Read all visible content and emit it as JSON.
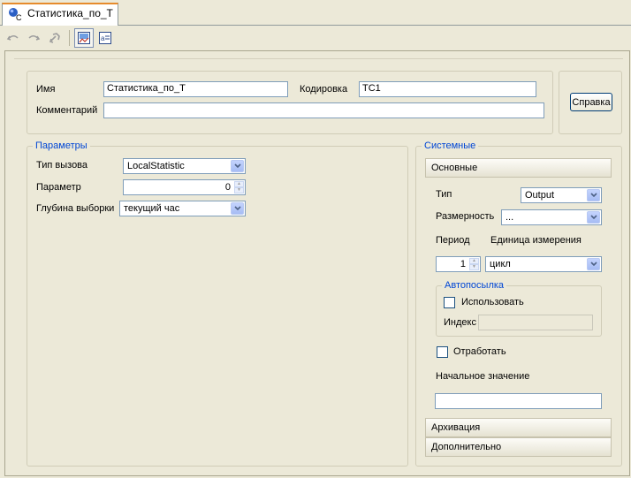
{
  "tab": {
    "label": "Статистика_по_Т",
    "icon": "function-block-icon"
  },
  "toolbar": {
    "undo_icon": "undo-icon",
    "redo_icon": "redo-icon",
    "link_icon": "link-icon",
    "view_graphic_icon": "graphic-view-icon",
    "view_text_icon": "text-view-icon"
  },
  "header": {
    "name_label": "Имя",
    "name_value": "Статистика_по_Т",
    "code_label": "Кодировка",
    "code_value": "TC1",
    "comment_label": "Комментарий",
    "comment_value": "",
    "help_button": "Справка"
  },
  "params": {
    "title": "Параметры",
    "call_type_label": "Тип вызова",
    "call_type_value": "LocalStatistic",
    "param_label": "Параметр",
    "param_value": "0",
    "depth_label": "Глубина выборки",
    "depth_value": "текущий час"
  },
  "system": {
    "title": "Системные",
    "main_section": "Основные",
    "type_label": "Тип",
    "type_value": "Output",
    "dimension_label": "Размерность",
    "dimension_value": "...",
    "period_label": "Период",
    "unit_label": "Единица измерения",
    "period_value": "1",
    "unit_value": "цикл",
    "autosend": {
      "title": "Автопосылка",
      "use_label": "Использовать",
      "use_checked": false,
      "index_label": "Индекс",
      "index_value": ""
    },
    "process_label": "Отработать",
    "process_checked": false,
    "initial_label": "Начальное значение",
    "initial_value": "",
    "archive_section": "Архивация",
    "extra_section": "Дополнительно"
  },
  "colors": {
    "group_title": "#0046d5",
    "background": "#ece9d8",
    "tab_accent": "#e68b2c"
  }
}
